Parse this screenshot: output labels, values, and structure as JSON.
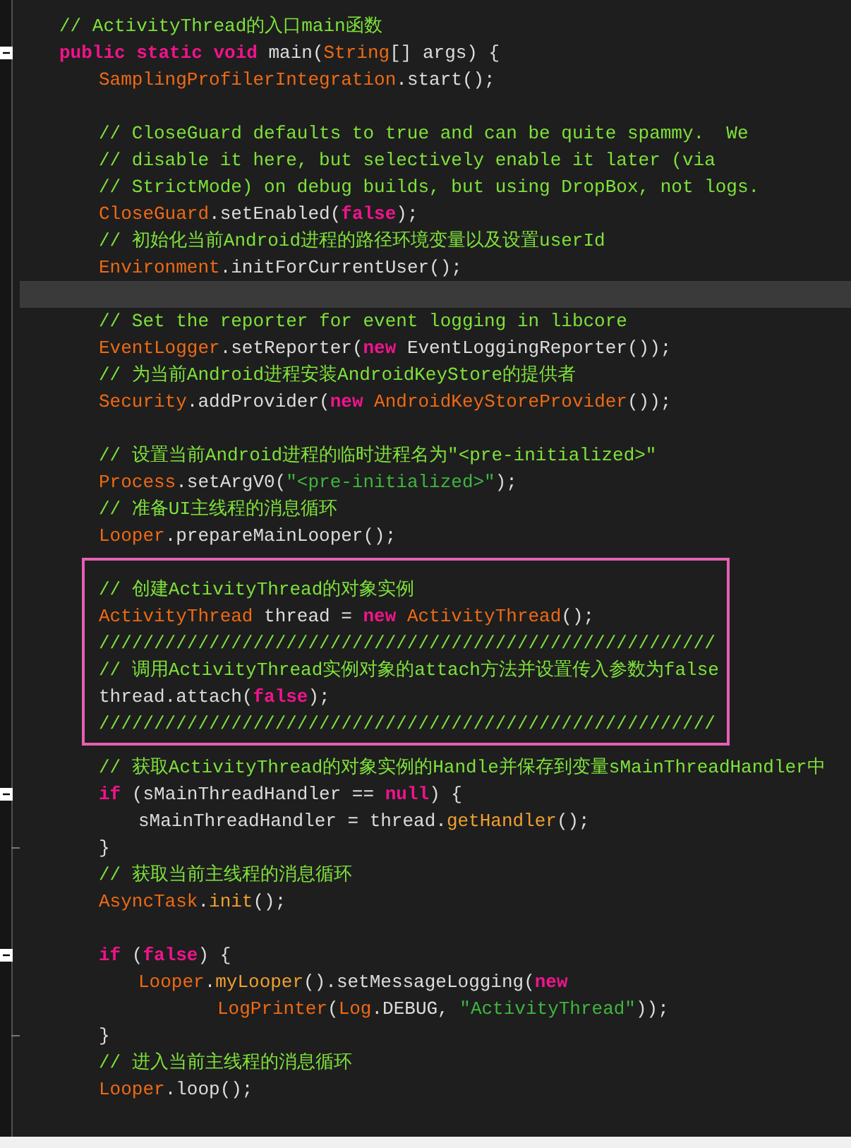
{
  "lines": [
    {
      "kind": "code",
      "tokens": [
        {
          "t": "// ActivityThread的入口main函数",
          "kind": "comment"
        }
      ]
    },
    {
      "kind": "code",
      "fold": true,
      "tokens": [
        {
          "t": "public static void",
          "kind": "keyword"
        },
        {
          "t": " main(",
          "kind": "plain"
        },
        {
          "t": "String",
          "kind": "type"
        },
        {
          "t": "[] args) {",
          "kind": "plain"
        }
      ],
      "children": [
        {
          "kind": "code",
          "tokens": [
            {
              "t": "SamplingProfilerIntegration",
              "kind": "type"
            },
            {
              "t": ".start();",
              "kind": "plain"
            }
          ]
        },
        {
          "kind": "blank",
          "current": false
        },
        {
          "kind": "code",
          "tokens": [
            {
              "t": "// CloseGuard defaults to true and can be quite spammy.  We",
              "kind": "comment"
            }
          ]
        },
        {
          "kind": "code",
          "tokens": [
            {
              "t": "// disable it here, but selectively enable it later (via",
              "kind": "comment"
            }
          ]
        },
        {
          "kind": "code",
          "tokens": [
            {
              "t": "// StrictMode) on debug builds, but using DropBox, not logs.",
              "kind": "comment"
            }
          ]
        },
        {
          "kind": "code",
          "tokens": [
            {
              "t": "CloseGuard",
              "kind": "type"
            },
            {
              "t": ".setEnabled(",
              "kind": "plain"
            },
            {
              "t": "false",
              "kind": "keyword"
            },
            {
              "t": ");",
              "kind": "plain"
            }
          ]
        },
        {
          "kind": "code",
          "tokens": [
            {
              "t": "// 初始化当前Android进程的路径环境变量以及设置userId",
              "kind": "comment"
            }
          ]
        },
        {
          "kind": "code",
          "tokens": [
            {
              "t": "Environment",
              "kind": "type"
            },
            {
              "t": ".initForCurrentUser();",
              "kind": "plain"
            }
          ]
        },
        {
          "kind": "blank",
          "current": true
        },
        {
          "kind": "code",
          "tokens": [
            {
              "t": "// Set the reporter for event logging in libcore",
              "kind": "comment"
            }
          ]
        },
        {
          "kind": "code",
          "tokens": [
            {
              "t": "EventLogger",
              "kind": "type"
            },
            {
              "t": ".setReporter(",
              "kind": "plain"
            },
            {
              "t": "new",
              "kind": "keyword"
            },
            {
              "t": " EventLoggingReporter());",
              "kind": "plain"
            }
          ]
        },
        {
          "kind": "code",
          "tokens": [
            {
              "t": "// 为当前Android进程安装AndroidKeyStore的提供者",
              "kind": "comment"
            }
          ]
        },
        {
          "kind": "code",
          "tokens": [
            {
              "t": "Security",
              "kind": "type"
            },
            {
              "t": ".addProvider(",
              "kind": "plain"
            },
            {
              "t": "new",
              "kind": "keyword"
            },
            {
              "t": " AndroidKeyStoreProvider",
              "kind": "type"
            },
            {
              "t": "());",
              "kind": "plain"
            }
          ]
        },
        {
          "kind": "blank",
          "current": false
        },
        {
          "kind": "code",
          "tokens": [
            {
              "t": "// 设置当前Android进程的临时进程名为\"<pre-initialized>\"",
              "kind": "comment"
            }
          ]
        },
        {
          "kind": "code",
          "tokens": [
            {
              "t": "Process",
              "kind": "type"
            },
            {
              "t": ".setArgV0(",
              "kind": "plain"
            },
            {
              "t": "\"<pre-initialized>\"",
              "kind": "string"
            },
            {
              "t": ");",
              "kind": "plain"
            }
          ]
        },
        {
          "kind": "code",
          "tokens": [
            {
              "t": "// 准备UI主线程的消息循环",
              "kind": "comment"
            }
          ]
        },
        {
          "kind": "code",
          "tokens": [
            {
              "t": "Looper",
              "kind": "type"
            },
            {
              "t": ".prepareMainLooper();",
              "kind": "plain"
            }
          ]
        },
        {
          "kind": "box",
          "children": [
            {
              "kind": "code",
              "tokens": [
                {
                  "t": "// 创建ActivityThread的对象实例",
                  "kind": "comment"
                }
              ]
            },
            {
              "kind": "code",
              "tokens": [
                {
                  "t": "ActivityThread",
                  "kind": "type"
                },
                {
                  "t": " thread = ",
                  "kind": "plain"
                },
                {
                  "t": "new",
                  "kind": "keyword"
                },
                {
                  "t": " ActivityThread",
                  "kind": "type"
                },
                {
                  "t": "();",
                  "kind": "plain"
                }
              ]
            },
            {
              "kind": "code",
              "tokens": [
                {
                  "t": "////////////////////////////////////////////////////////",
                  "kind": "comment"
                }
              ]
            },
            {
              "kind": "code",
              "tokens": [
                {
                  "t": "// 调用ActivityThread实例对象的attach方法并设置传入参数为false",
                  "kind": "comment"
                }
              ]
            },
            {
              "kind": "code",
              "tokens": [
                {
                  "t": "thread.attach(",
                  "kind": "plain"
                },
                {
                  "t": "false",
                  "kind": "keyword"
                },
                {
                  "t": ");",
                  "kind": "plain"
                }
              ]
            },
            {
              "kind": "code",
              "tokens": [
                {
                  "t": "////////////////////////////////////////////////////////",
                  "kind": "comment"
                }
              ]
            }
          ]
        },
        {
          "kind": "code",
          "tokens": [
            {
              "t": "// 获取ActivityThread的对象实例的Handle并保存到变量sMainThreadHandler中",
              "kind": "comment"
            }
          ]
        },
        {
          "kind": "code",
          "fold": true,
          "tokens": [
            {
              "t": "if",
              "kind": "keyword"
            },
            {
              "t": " (sMainThreadHandler == ",
              "kind": "plain"
            },
            {
              "t": "null",
              "kind": "keyword"
            },
            {
              "t": ") {",
              "kind": "plain"
            }
          ],
          "children": [
            {
              "kind": "code",
              "tokens": [
                {
                  "t": "sMainThreadHandler = thread.",
                  "kind": "plain"
                },
                {
                  "t": "getHandler",
                  "kind": "method"
                },
                {
                  "t": "();",
                  "kind": "plain"
                }
              ]
            }
          ],
          "end_tokens": [
            {
              "t": "}",
              "kind": "plain"
            }
          ]
        },
        {
          "kind": "code",
          "tokens": [
            {
              "t": "// 获取当前主线程的消息循环",
              "kind": "comment"
            }
          ]
        },
        {
          "kind": "code",
          "tokens": [
            {
              "t": "AsyncTask",
              "kind": "type"
            },
            {
              "t": ".",
              "kind": "plain"
            },
            {
              "t": "init",
              "kind": "method"
            },
            {
              "t": "();",
              "kind": "plain"
            }
          ]
        },
        {
          "kind": "blank",
          "current": false
        },
        {
          "kind": "code",
          "fold": true,
          "tokens": [
            {
              "t": "if",
              "kind": "keyword"
            },
            {
              "t": " (",
              "kind": "plain"
            },
            {
              "t": "false",
              "kind": "keyword"
            },
            {
              "t": ") {",
              "kind": "plain"
            }
          ],
          "children": [
            {
              "kind": "code",
              "tokens": [
                {
                  "t": "Looper",
                  "kind": "type"
                },
                {
                  "t": ".",
                  "kind": "plain"
                },
                {
                  "t": "myLooper",
                  "kind": "method"
                },
                {
                  "t": "().setMessageLogging(",
                  "kind": "plain"
                },
                {
                  "t": "new",
                  "kind": "keyword"
                }
              ],
              "children": [
                {
                  "kind": "continuation",
                  "tokens": [
                    {
                      "t": "LogPrinter",
                      "kind": "type"
                    },
                    {
                      "t": "(",
                      "kind": "plain"
                    },
                    {
                      "t": "Log",
                      "kind": "type"
                    },
                    {
                      "t": ".DEBUG, ",
                      "kind": "plain"
                    },
                    {
                      "t": "\"ActivityThread\"",
                      "kind": "string"
                    },
                    {
                      "t": "));",
                      "kind": "plain"
                    }
                  ]
                }
              ]
            }
          ],
          "end_tokens": [
            {
              "t": "}",
              "kind": "plain"
            }
          ]
        },
        {
          "kind": "code",
          "tokens": [
            {
              "t": "// 进入当前主线程的消息循环",
              "kind": "comment"
            }
          ]
        },
        {
          "kind": "code",
          "tokens": [
            {
              "t": "Looper",
              "kind": "type"
            },
            {
              "t": ".loop();",
              "kind": "plain"
            }
          ]
        }
      ]
    }
  ]
}
